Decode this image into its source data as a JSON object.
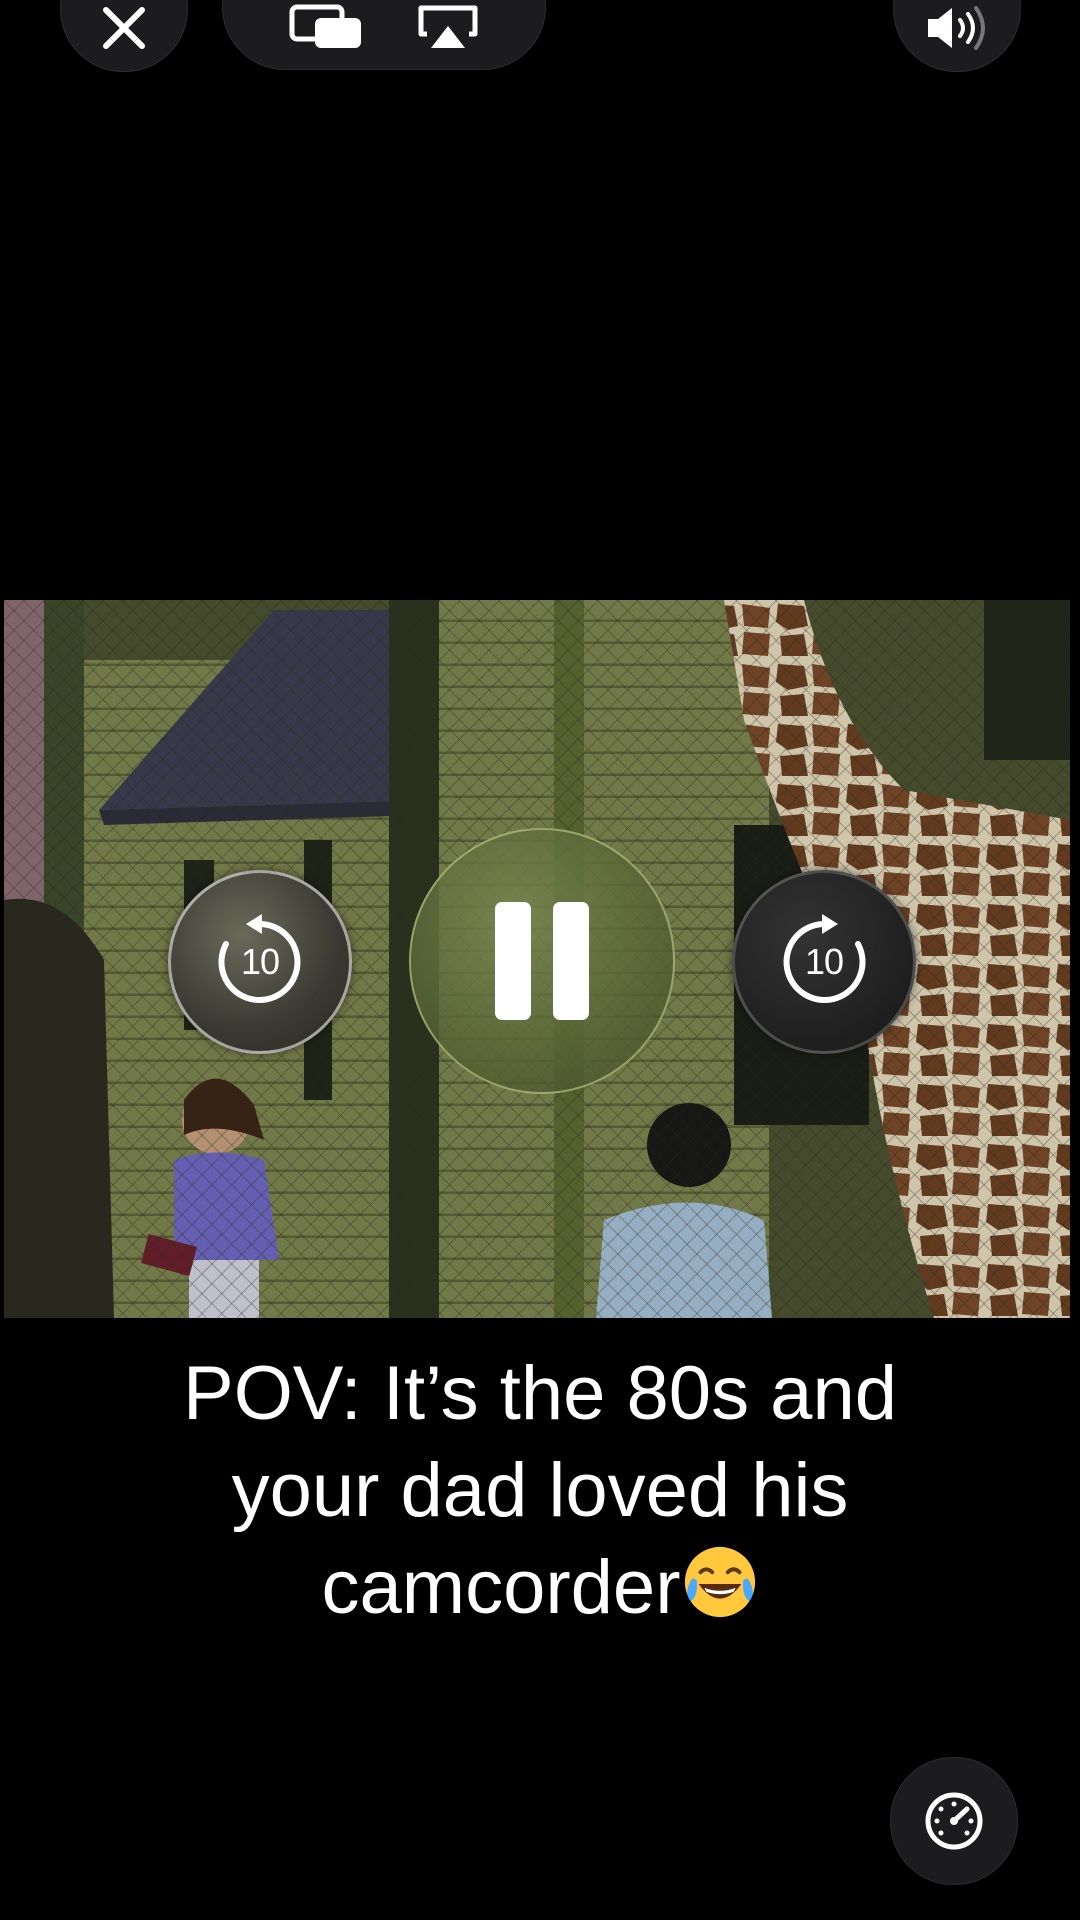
{
  "top_bar": {
    "close_icon": "close-icon",
    "pip_icon": "picture-in-picture-icon",
    "airplay_icon": "airplay-icon",
    "volume_icon": "speaker-volume-icon"
  },
  "video": {
    "scene_description_icon": "video-frame"
  },
  "controls": {
    "skip_back_seconds": "10",
    "skip_forward_seconds": "10",
    "pause_icon": "pause-icon",
    "skip_back_icon": "skip-back-10-icon",
    "skip_forward_icon": "skip-forward-10-icon"
  },
  "caption": {
    "line1": "POV: It’s the 80s and",
    "line2": "your dad loved his",
    "line3": "camcorder",
    "emoji_icon": "face-with-tears-of-joy-icon"
  },
  "speed_button": {
    "icon": "speedometer-icon"
  },
  "colors": {
    "background": "#000000",
    "control_pill": "#1c1c1e",
    "text": "#ffffff",
    "play_button_tint": "#6e7c44"
  }
}
